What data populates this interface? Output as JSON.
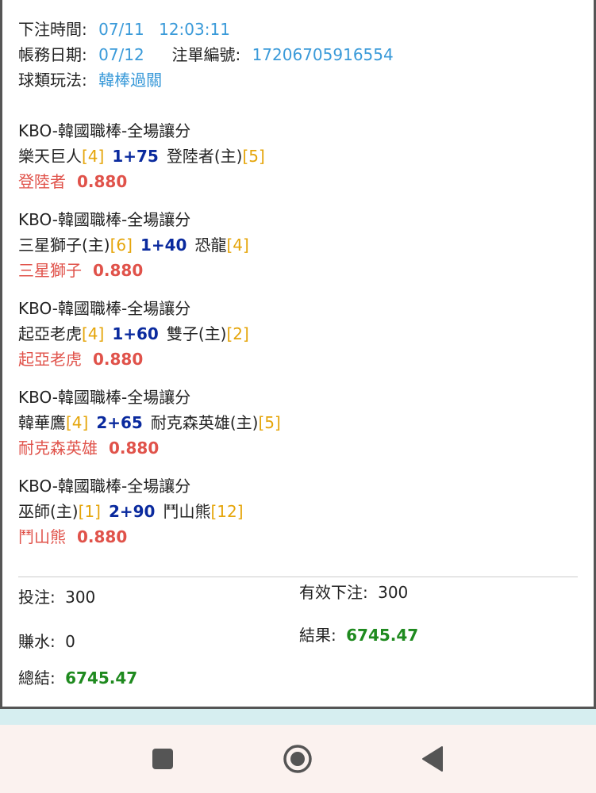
{
  "ticket": {
    "bet_time": {
      "label": "下注時間:",
      "date": "07/11",
      "time": "12:03:11"
    },
    "account_date": {
      "label": "帳務日期:",
      "value": "07/12"
    },
    "order_no": {
      "label": "注單編號:",
      "value": "17206705916554"
    },
    "play_type": {
      "label": "球類玩法:",
      "value": "韓棒過關"
    }
  },
  "bets": [
    {
      "header": "KBO-韓國職棒-全場讓分",
      "team1": "樂天巨人",
      "rank1": "[4]",
      "handicap": "1+75",
      "team2": "登陸者(主)",
      "rank2": "[5]",
      "pick": "登陸者",
      "odds": "0.880"
    },
    {
      "header": "KBO-韓國職棒-全場讓分",
      "team1": "三星獅子(主)",
      "rank1": "[6]",
      "handicap": "1+40",
      "team2": "恐龍",
      "rank2": "[4]",
      "pick": "三星獅子",
      "odds": "0.880"
    },
    {
      "header": "KBO-韓國職棒-全場讓分",
      "team1": "起亞老虎",
      "rank1": "[4]",
      "handicap": "1+60",
      "team2": "雙子(主)",
      "rank2": "[2]",
      "pick": "起亞老虎",
      "odds": "0.880"
    },
    {
      "header": "KBO-韓國職棒-全場讓分",
      "team1": "韓華鷹",
      "rank1": "[4]",
      "handicap": "2+65",
      "team2": "耐克森英雄(主)",
      "rank2": "[5]",
      "pick": "耐克森英雄",
      "odds": "0.880"
    },
    {
      "header": "KBO-韓國職棒-全場讓分",
      "team1": "巫師(主)",
      "rank1": "[1]",
      "handicap": "2+90",
      "team2": "鬥山熊",
      "rank2": "[12]",
      "pick": "鬥山熊",
      "odds": "0.880"
    }
  ],
  "summary": {
    "stake": {
      "label": "投注:",
      "value": "300"
    },
    "valid_stake": {
      "label": "有效下注:",
      "value": "300"
    },
    "rebate": {
      "label": "賺水:",
      "value": "0"
    },
    "result": {
      "label": "結果:",
      "value": "6745.47"
    },
    "total": {
      "label": "總結:",
      "value": "6745.47"
    }
  },
  "navbar": {
    "icons": [
      "recent-apps-icon",
      "home-icon",
      "back-icon"
    ]
  },
  "colors": {
    "meta_value": "#3a9ad9",
    "rank": "#e5a50a",
    "handicap": "#0a2a9e",
    "pick": "#e0524a",
    "positive": "#1f8a1f"
  }
}
